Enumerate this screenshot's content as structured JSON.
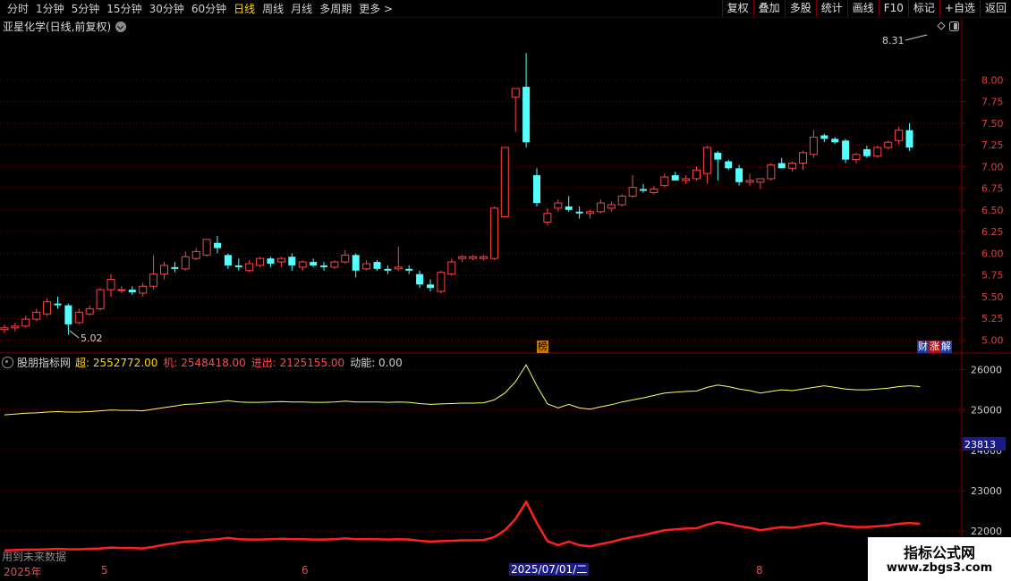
{
  "toolbar": {
    "periods": [
      "分时",
      "1分钟",
      "5分钟",
      "15分钟",
      "30分钟",
      "60分钟",
      "日线",
      "周线",
      "月线",
      "多周期",
      "更多 >"
    ],
    "active_period": "日线",
    "right_buttons": [
      "复权",
      "叠加",
      "多股",
      "统计",
      "画线",
      "F10",
      "标记",
      "+自选",
      "返回"
    ]
  },
  "stock": {
    "title": "亚星化学(日线,前复权)"
  },
  "price_axis": {
    "ticks": [
      "8.00",
      "7.75",
      "7.50",
      "7.25",
      "7.00",
      "6.75",
      "6.50",
      "6.25",
      "6.00",
      "5.75",
      "5.50",
      "5.25",
      "5.00"
    ],
    "high_label": "8.31",
    "low_label": "5.02"
  },
  "indicator": {
    "name": "股朋指标网",
    "chao_label": "超: 2552772.00",
    "ji_label": "机: 2548418.00",
    "jinchu_label": "进出: 2125155.00",
    "dong_label": "动能: 0.00",
    "axis_ticks": [
      "26000",
      "25000",
      "24000",
      "23000",
      "22000"
    ],
    "current_marker": "23813"
  },
  "badges": {
    "bang": "榜",
    "cai": "财",
    "zhang": "涨",
    "jie": "解"
  },
  "future_note": "用到未来数据",
  "date_axis": {
    "labels": [
      "2025年",
      "5",
      "6",
      "8"
    ],
    "selected": "2025/07/01/二"
  },
  "watermark": {
    "line1": "指标公式网",
    "line2": "www.zbgs3.com"
  },
  "colors": {
    "up": "#ff4444",
    "down": "#54ffff",
    "yellow_line": "#ffff66",
    "red_line": "#ff2020",
    "grid": "#7a0000"
  },
  "chart_data": {
    "type": "candlestick",
    "candles": [
      [
        5.12,
        5.18,
        5.08,
        5.14
      ],
      [
        5.14,
        5.2,
        5.1,
        5.16
      ],
      [
        5.16,
        5.28,
        5.14,
        5.24
      ],
      [
        5.24,
        5.36,
        5.22,
        5.32
      ],
      [
        5.3,
        5.48,
        5.28,
        5.44
      ],
      [
        5.42,
        5.5,
        5.36,
        5.4
      ],
      [
        5.4,
        5.42,
        5.06,
        5.18
      ],
      [
        5.2,
        5.36,
        5.18,
        5.32
      ],
      [
        5.3,
        5.4,
        5.28,
        5.36
      ],
      [
        5.36,
        5.6,
        5.34,
        5.58
      ],
      [
        5.58,
        5.76,
        5.5,
        5.7
      ],
      [
        5.58,
        5.62,
        5.54,
        5.58
      ],
      [
        5.58,
        5.62,
        5.52,
        5.55
      ],
      [
        5.54,
        5.66,
        5.5,
        5.62
      ],
      [
        5.62,
        5.98,
        5.58,
        5.76
      ],
      [
        5.76,
        5.9,
        5.7,
        5.86
      ],
      [
        5.84,
        5.9,
        5.78,
        5.82
      ],
      [
        5.82,
        6.02,
        5.8,
        5.96
      ],
      [
        5.94,
        6.06,
        5.92,
        6.02
      ],
      [
        5.98,
        6.16,
        5.96,
        6.16
      ],
      [
        6.12,
        6.2,
        6.0,
        6.06
      ],
      [
        5.98,
        6.0,
        5.82,
        5.86
      ],
      [
        5.86,
        5.94,
        5.8,
        5.84
      ],
      [
        5.8,
        5.92,
        5.78,
        5.88
      ],
      [
        5.86,
        5.96,
        5.84,
        5.94
      ],
      [
        5.94,
        5.96,
        5.84,
        5.88
      ],
      [
        5.9,
        5.96,
        5.84,
        5.94
      ],
      [
        5.96,
        6.0,
        5.8,
        5.86
      ],
      [
        5.84,
        5.92,
        5.8,
        5.9
      ],
      [
        5.9,
        5.94,
        5.84,
        5.86
      ],
      [
        5.86,
        5.9,
        5.8,
        5.84
      ],
      [
        5.84,
        5.92,
        5.82,
        5.9
      ],
      [
        5.9,
        6.04,
        5.88,
        5.98
      ],
      [
        5.98,
        6.0,
        5.72,
        5.8
      ],
      [
        5.82,
        5.92,
        5.8,
        5.88
      ],
      [
        5.9,
        5.92,
        5.8,
        5.82
      ],
      [
        5.82,
        5.86,
        5.76,
        5.8
      ],
      [
        5.82,
        6.08,
        5.8,
        5.84
      ],
      [
        5.82,
        5.86,
        5.76,
        5.8
      ],
      [
        5.76,
        5.8,
        5.6,
        5.64
      ],
      [
        5.64,
        5.7,
        5.56,
        5.6
      ],
      [
        5.56,
        5.8,
        5.54,
        5.78
      ],
      [
        5.76,
        5.94,
        5.74,
        5.9
      ],
      [
        5.94,
        5.98,
        5.9,
        5.96
      ],
      [
        5.94,
        5.98,
        5.92,
        5.96
      ],
      [
        5.94,
        5.98,
        5.92,
        5.96
      ],
      [
        5.94,
        6.54,
        5.92,
        6.52
      ],
      [
        6.42,
        7.22,
        6.42,
        7.22
      ],
      [
        7.8,
        7.9,
        7.4,
        7.9
      ],
      [
        7.92,
        8.31,
        7.22,
        7.28
      ],
      [
        6.9,
        6.98,
        6.54,
        6.58
      ],
      [
        6.36,
        6.52,
        6.32,
        6.46
      ],
      [
        6.52,
        6.62,
        6.48,
        6.58
      ],
      [
        6.54,
        6.66,
        6.48,
        6.5
      ],
      [
        6.48,
        6.54,
        6.4,
        6.46
      ],
      [
        6.46,
        6.5,
        6.4,
        6.48
      ],
      [
        6.48,
        6.62,
        6.46,
        6.58
      ],
      [
        6.52,
        6.6,
        6.48,
        6.56
      ],
      [
        6.56,
        6.68,
        6.54,
        6.66
      ],
      [
        6.66,
        6.9,
        6.64,
        6.76
      ],
      [
        6.74,
        6.8,
        6.7,
        6.72
      ],
      [
        6.7,
        6.78,
        6.68,
        6.74
      ],
      [
        6.78,
        6.92,
        6.76,
        6.88
      ],
      [
        6.9,
        6.94,
        6.84,
        6.84
      ],
      [
        6.84,
        6.9,
        6.8,
        6.86
      ],
      [
        6.86,
        7.0,
        6.84,
        6.96
      ],
      [
        6.92,
        7.24,
        6.8,
        7.22
      ],
      [
        7.16,
        7.18,
        6.84,
        7.08
      ],
      [
        7.06,
        7.08,
        6.96,
        6.98
      ],
      [
        6.98,
        7.02,
        6.78,
        6.82
      ],
      [
        6.82,
        6.92,
        6.78,
        6.84
      ],
      [
        6.82,
        6.86,
        6.74,
        6.86
      ],
      [
        6.86,
        7.04,
        6.84,
        7.02
      ],
      [
        7.04,
        7.1,
        7.0,
        6.98
      ],
      [
        6.98,
        7.06,
        6.94,
        7.04
      ],
      [
        7.04,
        7.18,
        6.96,
        7.16
      ],
      [
        7.14,
        7.42,
        7.1,
        7.34
      ],
      [
        7.36,
        7.38,
        7.28,
        7.32
      ],
      [
        7.32,
        7.34,
        7.26,
        7.28
      ],
      [
        7.3,
        7.32,
        7.04,
        7.08
      ],
      [
        7.08,
        7.16,
        7.04,
        7.14
      ],
      [
        7.2,
        7.24,
        7.1,
        7.12
      ],
      [
        7.12,
        7.24,
        7.1,
        7.22
      ],
      [
        7.22,
        7.3,
        7.2,
        7.28
      ],
      [
        7.3,
        7.46,
        7.26,
        7.42
      ],
      [
        7.42,
        7.5,
        7.18,
        7.22
      ]
    ],
    "yellow_line": [
      24880,
      24900,
      24920,
      24930,
      24950,
      24960,
      24950,
      24950,
      24960,
      24980,
      25000,
      24990,
      24990,
      24980,
      25020,
      25060,
      25100,
      25140,
      25150,
      25180,
      25200,
      25230,
      25200,
      25190,
      25190,
      25200,
      25210,
      25200,
      25200,
      25190,
      25190,
      25200,
      25220,
      25200,
      25200,
      25200,
      25190,
      25200,
      25190,
      25160,
      25140,
      25150,
      25160,
      25170,
      25170,
      25180,
      25250,
      25420,
      25700,
      26120,
      25600,
      25150,
      25050,
      25140,
      25050,
      25020,
      25080,
      25130,
      25200,
      25250,
      25300,
      25360,
      25420,
      25440,
      25460,
      25470,
      25560,
      25620,
      25580,
      25520,
      25480,
      25420,
      25460,
      25500,
      25480,
      25520,
      25560,
      25600,
      25560,
      25520,
      25500,
      25500,
      25520,
      25540,
      25580,
      25600,
      25580
    ],
    "red_line": [
      21520,
      21530,
      21540,
      21540,
      21550,
      21560,
      21550,
      21550,
      21560,
      21570,
      21590,
      21580,
      21580,
      21570,
      21610,
      21660,
      21700,
      21740,
      21750,
      21780,
      21800,
      21830,
      21800,
      21790,
      21790,
      21800,
      21810,
      21800,
      21800,
      21790,
      21790,
      21800,
      21820,
      21800,
      21800,
      21800,
      21790,
      21800,
      21790,
      21760,
      21740,
      21750,
      21760,
      21770,
      21770,
      21780,
      21850,
      22020,
      22300,
      22720,
      22200,
      21750,
      21650,
      21740,
      21650,
      21620,
      21680,
      21730,
      21800,
      21850,
      21900,
      21960,
      22020,
      22040,
      22060,
      22070,
      22160,
      22220,
      22180,
      22120,
      22080,
      22020,
      22060,
      22100,
      22080,
      22120,
      22160,
      22200,
      22160,
      22120,
      22100,
      22100,
      22120,
      22140,
      22180,
      22200,
      22180
    ],
    "price_ylim": [
      4.88,
      8.55
    ],
    "indicator_ylim": [
      21250,
      26300
    ]
  }
}
